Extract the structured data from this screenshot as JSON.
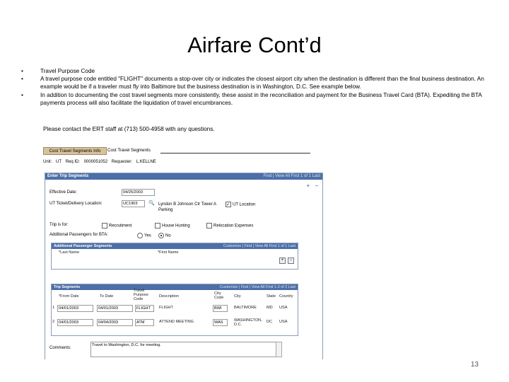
{
  "slide": {
    "title": "Airfare Cont’d",
    "bullet_glyph": "•",
    "bullets": [
      "Travel Purpose Code",
      "A travel purpose code entitled \"FLIGHT\" documents a stop-over city or indicates the closest airport city when the destination is different than the final business destination. An example would be if a traveler must fly into Baltimore but the business destination is in Washington, D.C. See example below.",
      "In addition to documenting the cost travel segments more consistently, these assist in the reconciliation and payment for the Business Travel Card (BTA). Expediting the BTA payments process will also facilitate the liquidation of travel encumbrances."
    ],
    "contact": "Please contact the ERT staff at (713) 500-4958 with any questions.",
    "page_number": "13"
  },
  "screenshot": {
    "tabs": [
      "Cost Travel Segments Info",
      "Cost Travel Segments"
    ],
    "unit_label": "Unit:",
    "unit_value": "UT",
    "reqid_label": "Req ID:",
    "reqid_value": "0000051052",
    "requester_label": "Requester:",
    "requester_value": "L.KELLNE",
    "enter_trip_title": "Enter Trip Segments",
    "enter_trip_nav": "Find | View All  First  1 of 1  Last",
    "effective_date_label": "Effective Date:",
    "effective_date_value": "04/25/2003",
    "ticket_loc_label": "UT Ticket/Delivery Location:",
    "ticket_loc_value": "UC1903",
    "ticket_loc_desc": "Lyndon B Johnson Ctr Tower A Parking",
    "ut_location_label": "UT Location",
    "trip_for_label": "Trip is for:",
    "trip_for_options": [
      "Recruitment",
      "House Hunting",
      "Relocation Expenses"
    ],
    "addl_pass_label": "Additional Passengers for BTA:",
    "radio_yes": "Yes",
    "radio_no": "No",
    "addl_seg_title": "Additional Passenger Segments",
    "addl_seg_nav": "Customize | Find | View All  First  1 of 1  Last",
    "addl_cols": [
      "*Last Name",
      "*First Name"
    ],
    "trip_seg_title": "Trip Segments",
    "trip_seg_nav": "Customize | Find | View All  First  1-2 of 2  Last",
    "trip_cols": [
      "*From Date",
      "To Date",
      "Travel Purpose Code",
      "Description",
      "City Code",
      "City",
      "State",
      "Country"
    ],
    "rows": [
      {
        "num": "1",
        "from": "04/01/2003",
        "to": "04/01/2003",
        "purpose": "FLIGHT",
        "desc": "FLIGHT",
        "city_code": "BWI",
        "city": "BALTIMORE",
        "state": "MD",
        "country": "USA"
      },
      {
        "num": "2",
        "from": "04/01/2003",
        "to": "04/04/2003",
        "purpose": "ATM",
        "desc": "ATTEND MEETING",
        "city_code": "WAS",
        "city": "WASHINGTON, D.C.",
        "state": "DC",
        "country": "USA"
      }
    ],
    "comments_label": "Comments:",
    "comments_value": "Travel to Washington, D.C. for meeting."
  }
}
